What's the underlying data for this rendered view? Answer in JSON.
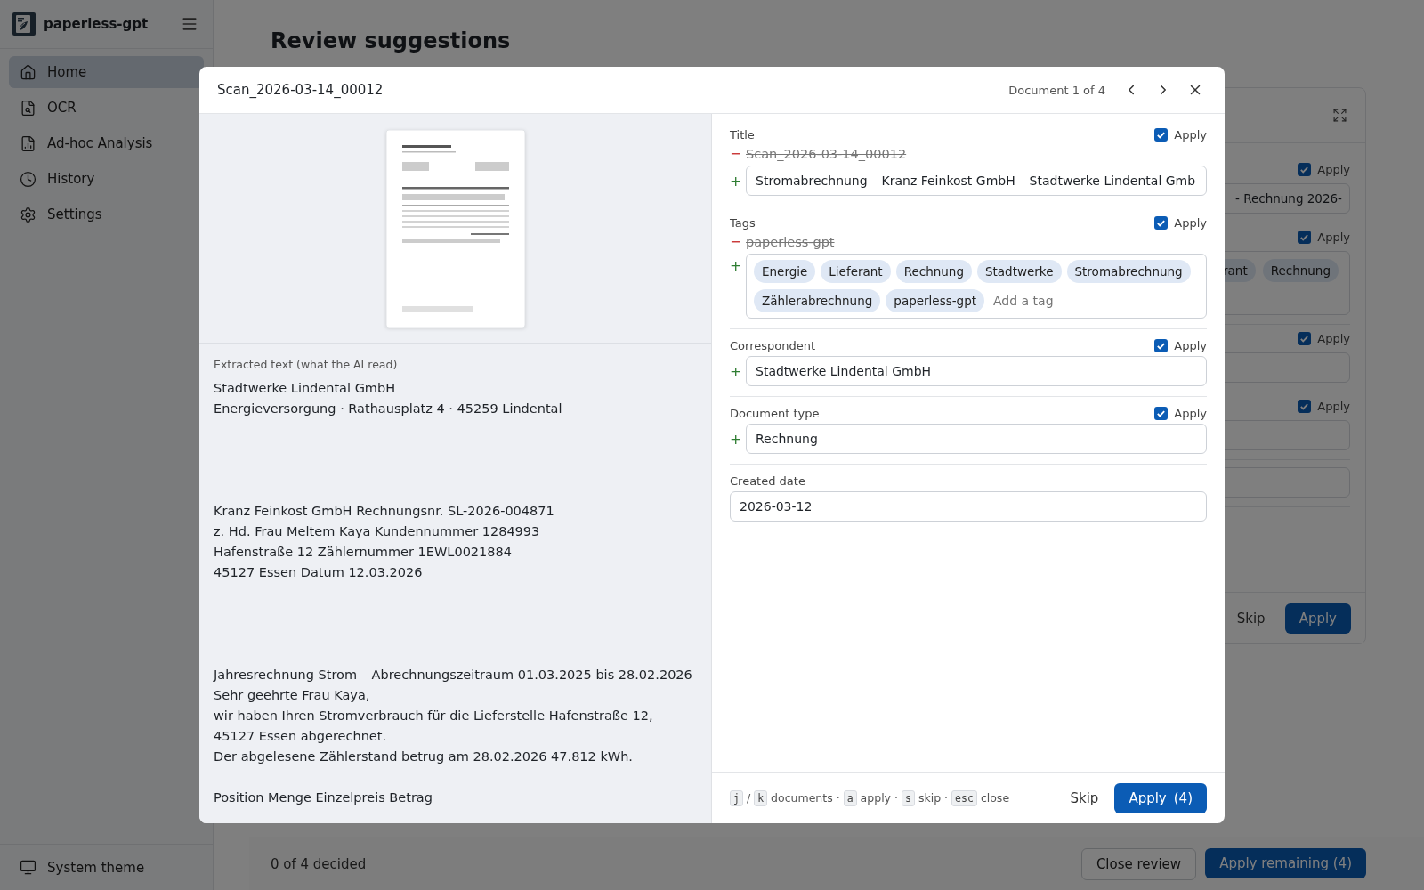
{
  "sidebar": {
    "app_name": "paperless-gpt",
    "items": [
      {
        "label": "Home",
        "selected": true
      },
      {
        "label": "OCR",
        "selected": false
      },
      {
        "label": "Ad-hoc Analysis",
        "selected": false
      },
      {
        "label": "History",
        "selected": false
      },
      {
        "label": "Settings",
        "selected": false
      }
    ],
    "theme_toggle": "System theme"
  },
  "page": {
    "title": "Review suggestions"
  },
  "background_card": {
    "rows": [
      {
        "kind": "field",
        "apply": true,
        "apply_label": "Apply",
        "value": "- Rechnung 2026-"
      },
      {
        "kind": "tags",
        "apply": true,
        "apply_label": "Apply",
        "tags": [
          "rant",
          "Rechnung"
        ]
      },
      {
        "kind": "field",
        "apply": true,
        "apply_label": "Apply"
      },
      {
        "kind": "field",
        "apply": true,
        "apply_label": "Apply"
      },
      {
        "kind": "field"
      }
    ],
    "skip": "Skip",
    "apply": "Apply"
  },
  "footer_bar": {
    "status": "0 of 4 decided",
    "close": "Close review",
    "apply_all": "Apply remaining (4)"
  },
  "modal": {
    "title": "Scan_2026-03-14_00012",
    "position": "Document 1 of 4",
    "extracted_label": "Extracted text (what the AI read)",
    "extracted_text": "Stadtwerke Lindental GmbH\nEnergieversorgung · Rathausplatz 4 · 45259 Lindental\n\n\n\n\nKranz Feinkost GmbH Rechnungsnr. SL-2026-004871\nz. Hd. Frau Meltem Kaya Kundennummer 1284993\nHafenstraße 12 Zählernummer 1EWL0021884\n45127 Essen Datum 12.03.2026\n\n\n\n\nJahresrechnung Strom – Abrechnungszeitraum 01.03.2025 bis 28.02.2026\nSehr geehrte Frau Kaya,\nwir haben Ihren Stromverbrauch für die Lieferstelle Hafenstraße 12, 45127 Essen abgerechnet.\nDer abgelesene Zählerstand betrug am 28.02.2026 47.812 kWh.\n\nPosition Menge Einzelpreis Betrag",
    "removed_mark": "−",
    "added_mark": "+",
    "fields": [
      {
        "kind": "text",
        "label": "Title",
        "apply": true,
        "apply_label": "Apply",
        "current": "Scan_2026-03-14_00012",
        "suggested": "Stromabrechnung – Kranz Feinkost GmbH – Stadtwerke Lindental Gmb"
      },
      {
        "kind": "tags",
        "label": "Tags",
        "apply": true,
        "apply_label": "Apply",
        "current": "paperless-gpt",
        "tags": [
          "Energie",
          "Lieferant",
          "Rechnung",
          "Stadtwerke",
          "Stromabrechnung",
          "Zählerabrechnung",
          "paperless-gpt"
        ],
        "placeholder": "Add a tag"
      },
      {
        "kind": "text",
        "label": "Correspondent",
        "apply": true,
        "apply_label": "Apply",
        "suggested": "Stadtwerke Lindental GmbH"
      },
      {
        "kind": "text",
        "label": "Document type",
        "apply": true,
        "apply_label": "Apply",
        "suggested": "Rechnung"
      },
      {
        "kind": "date",
        "label": "Created date",
        "value": "2026-03-12"
      }
    ],
    "key_joiner": "/",
    "separator": "·",
    "shortcuts": [
      {
        "keys": [
          "j",
          "k"
        ],
        "action": "documents"
      },
      {
        "keys": [
          "a"
        ],
        "action": "apply"
      },
      {
        "keys": [
          "s"
        ],
        "action": "skip"
      },
      {
        "keys": [
          "esc"
        ],
        "action": "close"
      }
    ],
    "skip": "Skip",
    "apply_button": {
      "label": "Apply",
      "count": "(4)"
    }
  }
}
